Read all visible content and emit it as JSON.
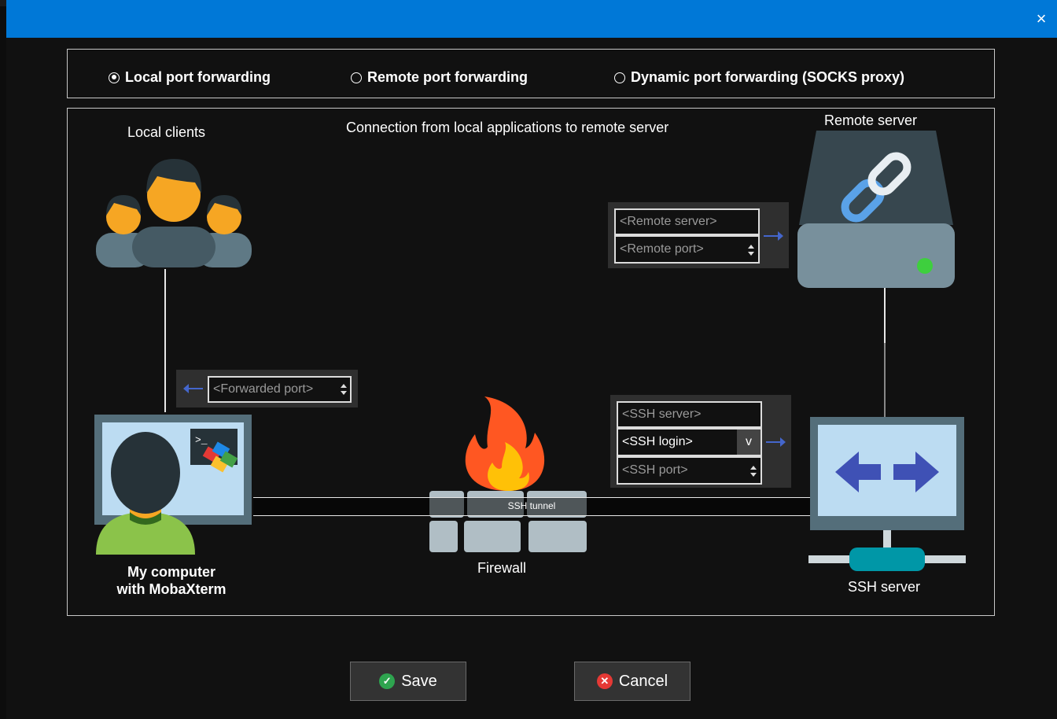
{
  "window": {
    "close_icon": "×"
  },
  "modes": [
    {
      "label": "Local port forwarding",
      "selected": true
    },
    {
      "label": "Remote port forwarding",
      "selected": false
    },
    {
      "label": "Dynamic port forwarding (SOCKS proxy)",
      "selected": false
    }
  ],
  "diagram": {
    "description": "Connection from local applications to remote server",
    "local_clients": "Local clients",
    "remote_server": "Remote server",
    "my_computer": "My computer\nwith MobaXterm",
    "firewall": "Firewall",
    "ssh_tunnel": "SSH tunnel",
    "ssh_server": "SSH server"
  },
  "fields": {
    "remote_server": {
      "placeholder": "<Remote server>"
    },
    "remote_port": {
      "placeholder": "<Remote port>"
    },
    "forwarded_port": {
      "placeholder": "<Forwarded port>"
    },
    "ssh_server": {
      "placeholder": "<SSH server>"
    },
    "ssh_login": {
      "value": "<SSH login>",
      "dropdown": "v"
    },
    "ssh_port": {
      "placeholder": "<SSH port>"
    }
  },
  "buttons": {
    "save": "Save",
    "cancel": "Cancel"
  },
  "colors": {
    "titlebar": "#0078d7",
    "save_icon": "#2ea44f",
    "cancel_icon": "#e53935",
    "arrow": "#4466cc"
  }
}
